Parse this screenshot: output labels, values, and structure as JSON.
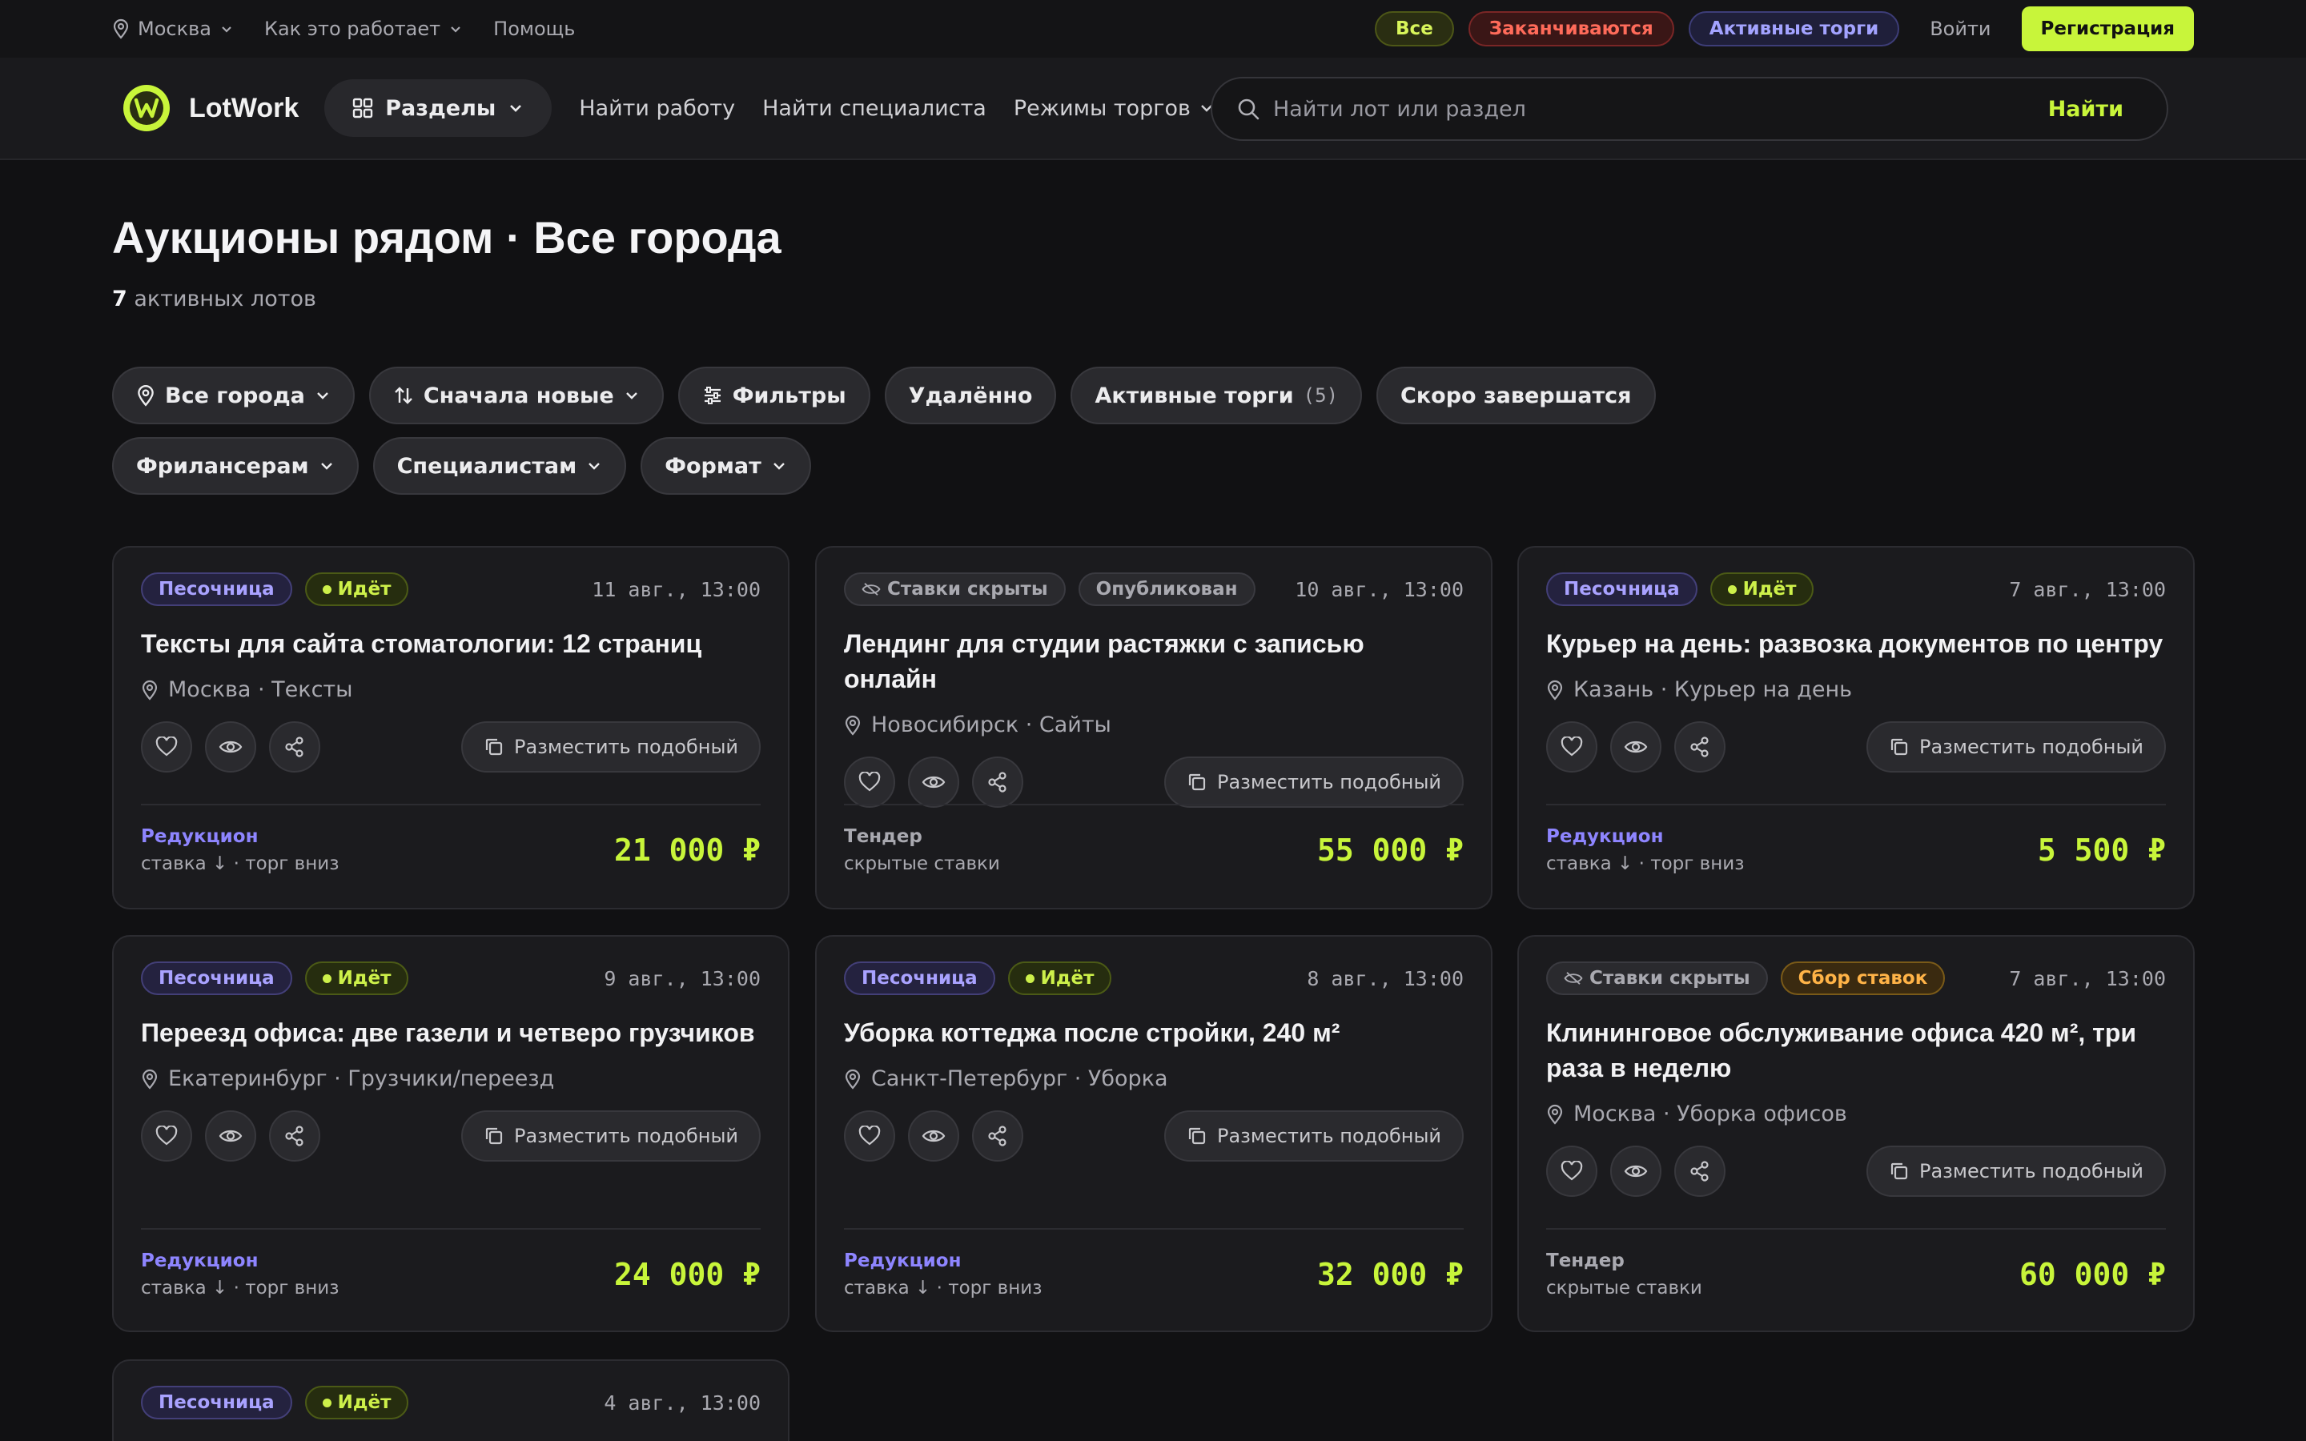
{
  "topbar": {
    "city": "Москва",
    "how_it_works": "Как это работает",
    "help": "Помощь",
    "filters": [
      "Все",
      "Заканчиваются",
      "Активные торги"
    ],
    "login": "Войти",
    "register": "Регистрация"
  },
  "nav": {
    "brand": "LotWork",
    "sections": "Разделы",
    "find_job": "Найти работу",
    "find_specialist": "Найти специалиста",
    "trade_modes": "Режимы торгов",
    "search_placeholder": "Найти лот или раздел",
    "search_button": "Найти"
  },
  "header": {
    "title": "Аукционы рядом · Все города",
    "count": "7",
    "count_label": " активных лотов"
  },
  "filters": {
    "city": "Все города",
    "sort": "Сначала новые",
    "filters": "Фильтры",
    "remote": "Удалённо",
    "active": "Активные торги",
    "active_count": "(5)",
    "ending": "Скоро завершатся",
    "freelancers": "Фрилансерам",
    "specialists": "Специалистам",
    "format": "Формат"
  },
  "similar_label": "Разместить подобный",
  "cards": [
    {
      "badges": [
        "Песочница",
        "Идёт"
      ],
      "date": "11 авг., 13:00",
      "title": "Тексты для сайта стоматологии: 12 страниц",
      "location": "Москва · Тексты",
      "mode": "Редукцион",
      "mode_desc": "ставка ↓ · торг вниз",
      "price": "21 000 ₽"
    },
    {
      "badges": [
        "Ставки скрыты",
        "Опубликован"
      ],
      "date": "10 авг., 13:00",
      "title": "Лендинг для студии растяжки с записью онлайн",
      "location": "Новосибирск · Сайты",
      "mode": "Тендер",
      "mode_desc": "скрытые ставки",
      "price": "55 000 ₽"
    },
    {
      "badges": [
        "Песочница",
        "Идёт"
      ],
      "date": "7 авг., 13:00",
      "title": "Курьер на день: развозка документов по центру",
      "location": "Казань · Курьер на день",
      "mode": "Редукцион",
      "mode_desc": "ставка ↓ · торг вниз",
      "price": "5 500 ₽"
    },
    {
      "badges": [
        "Песочница",
        "Идёт"
      ],
      "date": "9 авг., 13:00",
      "title": "Переезд офиса: две газели и четверо грузчиков",
      "location": "Екатеринбург · Грузчики/переезд",
      "mode": "Редукцион",
      "mode_desc": "ставка ↓ · торг вниз",
      "price": "24 000 ₽"
    },
    {
      "badges": [
        "Песочница",
        "Идёт"
      ],
      "date": "8 авг., 13:00",
      "title": "Уборка коттеджа после стройки, 240 м²",
      "location": "Санкт-Петербург · Уборка",
      "mode": "Редукцион",
      "mode_desc": "ставка ↓ · торг вниз",
      "price": "32 000 ₽"
    },
    {
      "badges": [
        "Ставки скрыты",
        "Сбор ставок"
      ],
      "date": "7 авг., 13:00",
      "title": "Клининговое обслуживание офиса 420 м², три раза в неделю",
      "location": "Москва · Уборка офисов",
      "mode": "Тендер",
      "mode_desc": "скрытые ставки",
      "price": "60 000 ₽"
    },
    {
      "badges": [
        "Песочница",
        "Идёт"
      ],
      "date": "4 авг., 13:00"
    }
  ],
  "colors": {
    "background": "#111113",
    "card": "#1B1B1E",
    "accent": "#C8F53A",
    "purple": "#8E85FF",
    "danger": "#FF6B5A"
  }
}
